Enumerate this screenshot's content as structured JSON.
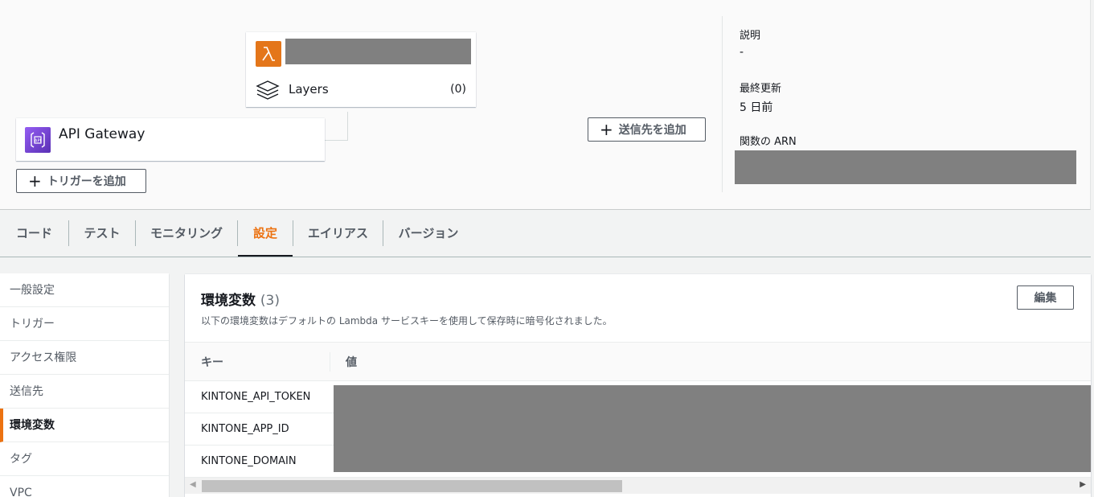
{
  "diagram": {
    "layers_label": "Layers",
    "layers_count": "(0)",
    "trigger_name": "API Gateway",
    "add_trigger_label": "トリガーを追加",
    "add_destination_label": "送信先を追加"
  },
  "meta": {
    "description_label": "説明",
    "description_value": "-",
    "last_modified_label": "最終更新",
    "last_modified_value": "5 日前",
    "arn_label": "関数の ARN"
  },
  "tabs": [
    {
      "label": "コード"
    },
    {
      "label": "テスト"
    },
    {
      "label": "モニタリング"
    },
    {
      "label": "設定"
    },
    {
      "label": "エイリアス"
    },
    {
      "label": "バージョン"
    }
  ],
  "active_tab": "設定",
  "sidebar": {
    "items": [
      {
        "label": "一般設定"
      },
      {
        "label": "トリガー"
      },
      {
        "label": "アクセス権限"
      },
      {
        "label": "送信先"
      },
      {
        "label": "環境変数"
      },
      {
        "label": "タグ"
      },
      {
        "label": "VPC"
      }
    ],
    "active": "環境変数"
  },
  "env": {
    "title": "環境変数",
    "count": "(3)",
    "description": "以下の環境変数はデフォルトの Lambda サービスキーを使用して保存時に暗号化されました。",
    "edit_label": "編集",
    "columns": {
      "key": "キー",
      "value": "値"
    },
    "rows": [
      {
        "key": "KINTONE_API_TOKEN"
      },
      {
        "key": "KINTONE_APP_ID"
      },
      {
        "key": "KINTONE_DOMAIN"
      }
    ]
  },
  "colors": {
    "accent": "#ec7211",
    "lambda_icon": "#e4761a",
    "api_gateway_icon": "#8c4fff",
    "redaction": "#808080"
  }
}
